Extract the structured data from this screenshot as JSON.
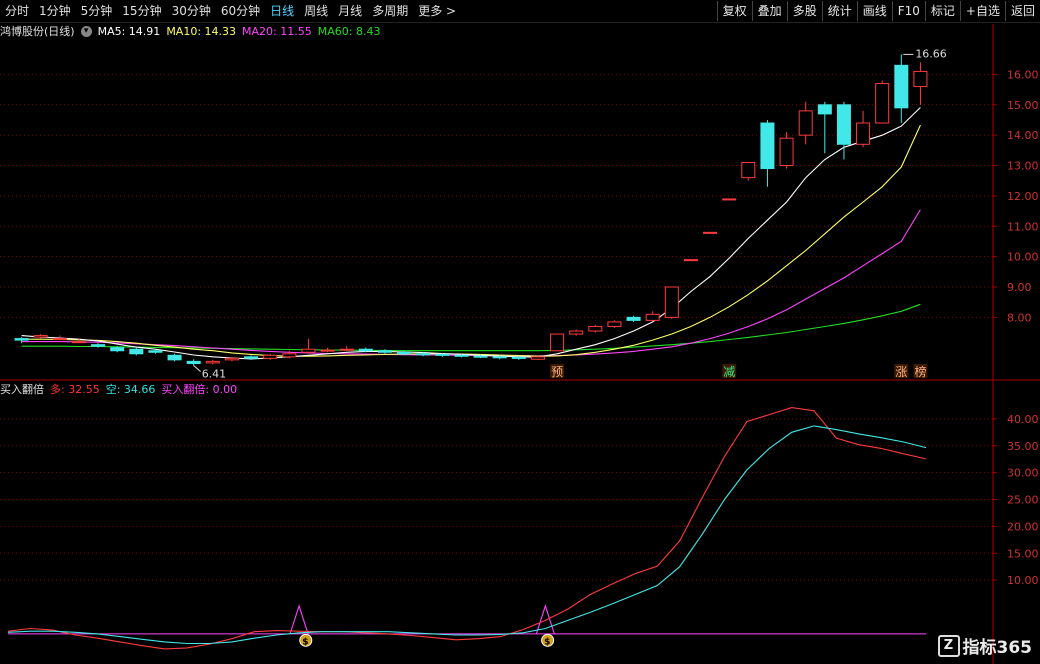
{
  "toolbar": {
    "periods": [
      "分时",
      "1分钟",
      "5分钟",
      "15分钟",
      "30分钟",
      "60分钟",
      "日线",
      "周线",
      "月线",
      "多周期",
      "更多 >"
    ],
    "active_period": "日线",
    "buttons": [
      "复权",
      "叠加",
      "多股",
      "统计",
      "画线",
      "F10",
      "标记",
      "+自选",
      "返回"
    ]
  },
  "main_panel": {
    "stock_label": "鸿博股份(日线)",
    "ma_indicators": [
      {
        "label": "MA5: 14.91",
        "color": "#ffffff"
      },
      {
        "label": "MA10: 14.33",
        "color": "#ffff66"
      },
      {
        "label": "MA20: 11.55",
        "color": "#ff44ff"
      },
      {
        "label": "MA60: 8.43",
        "color": "#22dd22"
      }
    ],
    "high_label": "16.66",
    "low_label": "6.41",
    "signals": [
      {
        "text": "预",
        "color": "#ffb080"
      },
      {
        "text": "减",
        "color": "#33ee88"
      },
      {
        "text": "涨",
        "color": "#ffb080"
      },
      {
        "text": "榜",
        "color": "#ffb080"
      }
    ]
  },
  "sub_panel": {
    "indicator_name": "买入翻倍",
    "values": [
      {
        "label": "多: 32.55",
        "color": "#ff3333"
      },
      {
        "label": "空: 34.66",
        "color": "#33e0e0"
      },
      {
        "label": "买入翻倍: 0.00",
        "color": "#ff44ff"
      }
    ]
  },
  "watermark": {
    "logo": "Z",
    "text": "指标365"
  },
  "colors": {
    "up": "#ff3b3b",
    "down": "#42e8e8",
    "ma5": "#ffffff",
    "ma10": "#ffff66",
    "ma20": "#ff44ff",
    "ma60": "#22dd22",
    "grid": "#8a0000",
    "axis_text": "#cc3333"
  },
  "chart_data": {
    "type": "candlestick",
    "price_axis_ticks": [
      "16.00",
      "15.00",
      "14.00",
      "13.00",
      "12.00",
      "11.00",
      "10.00",
      "9.00",
      "8.00"
    ],
    "price_range": [
      6.2,
      17.2
    ],
    "candles": [
      [
        7.3,
        7.25,
        7.35,
        7.15
      ],
      [
        7.35,
        7.4,
        7.45,
        7.3
      ],
      [
        7.3,
        7.3,
        7.4,
        7.25
      ],
      [
        7.2,
        7.2,
        7.3,
        7.15
      ],
      [
        7.1,
        7.05,
        7.15,
        7.0
      ],
      [
        7.0,
        6.9,
        7.05,
        6.85
      ],
      [
        6.95,
        6.8,
        7.0,
        6.75
      ],
      [
        6.9,
        6.85,
        6.95,
        6.8
      ],
      [
        6.75,
        6.6,
        6.8,
        6.55
      ],
      [
        6.55,
        6.48,
        6.62,
        6.41
      ],
      [
        6.5,
        6.55,
        6.6,
        6.45
      ],
      [
        6.6,
        6.65,
        6.7,
        6.55
      ],
      [
        6.7,
        6.65,
        6.75,
        6.6
      ],
      [
        6.65,
        6.75,
        6.8,
        6.6
      ],
      [
        6.7,
        6.8,
        6.9,
        6.65
      ],
      [
        6.85,
        6.95,
        7.3,
        6.8
      ],
      [
        6.9,
        6.92,
        7.0,
        6.85
      ],
      [
        6.95,
        6.95,
        7.05,
        6.9
      ],
      [
        6.95,
        6.9,
        7.0,
        6.85
      ],
      [
        6.9,
        6.85,
        6.95,
        6.8
      ],
      [
        6.85,
        6.8,
        6.9,
        6.75
      ],
      [
        6.8,
        6.78,
        6.85,
        6.72
      ],
      [
        6.78,
        6.75,
        6.82,
        6.7
      ],
      [
        6.75,
        6.72,
        6.8,
        6.68
      ],
      [
        6.72,
        6.7,
        6.78,
        6.66
      ],
      [
        6.7,
        6.68,
        6.75,
        6.62
      ],
      [
        6.68,
        6.65,
        6.72,
        6.6
      ],
      [
        6.62,
        6.7,
        6.72,
        6.6
      ],
      [
        6.9,
        7.45,
        7.45,
        6.88
      ],
      [
        7.45,
        7.55,
        7.6,
        7.4
      ],
      [
        7.55,
        7.7,
        7.75,
        7.5
      ],
      [
        7.7,
        7.85,
        7.9,
        7.65
      ],
      [
        8.0,
        7.9,
        8.05,
        7.85
      ],
      [
        7.9,
        8.1,
        8.2,
        7.88
      ],
      [
        8.0,
        9.0,
        9.0,
        7.95
      ],
      [
        9.9,
        9.9,
        9.9,
        9.9
      ],
      [
        10.8,
        10.8,
        10.8,
        10.8
      ],
      [
        11.9,
        11.9,
        11.9,
        11.9
      ],
      [
        12.6,
        13.1,
        13.1,
        12.5
      ],
      [
        14.4,
        12.9,
        14.5,
        12.3
      ],
      [
        13.0,
        13.9,
        14.1,
        12.9
      ],
      [
        14.0,
        14.8,
        15.1,
        13.7
      ],
      [
        15.0,
        14.7,
        15.1,
        13.4
      ],
      [
        15.0,
        13.7,
        15.1,
        13.2
      ],
      [
        13.7,
        14.4,
        14.8,
        13.6
      ],
      [
        14.4,
        15.7,
        15.8,
        14.4
      ],
      [
        16.3,
        14.9,
        16.66,
        14.4
      ],
      [
        15.6,
        16.1,
        16.4,
        15.0
      ]
    ],
    "ma5": [
      7.4,
      7.35,
      7.32,
      7.28,
      7.22,
      7.12,
      7.02,
      6.95,
      6.86,
      6.76,
      6.7,
      6.66,
      6.63,
      6.66,
      6.7,
      6.75,
      6.8,
      6.85,
      6.88,
      6.88,
      6.86,
      6.84,
      6.81,
      6.78,
      6.75,
      6.72,
      6.7,
      6.69,
      6.8,
      6.95,
      7.1,
      7.3,
      7.55,
      7.85,
      8.3,
      8.85,
      9.35,
      9.95,
      10.6,
      11.2,
      11.8,
      12.6,
      13.2,
      13.6,
      13.8,
      14.0,
      14.3,
      14.91
    ],
    "ma10": [
      7.28,
      7.28,
      7.27,
      7.26,
      7.24,
      7.2,
      7.15,
      7.08,
      7.02,
      6.95,
      6.9,
      6.83,
      6.78,
      6.74,
      6.72,
      6.72,
      6.73,
      6.75,
      6.76,
      6.78,
      6.79,
      6.8,
      6.8,
      6.79,
      6.78,
      6.76,
      6.74,
      6.72,
      6.73,
      6.77,
      6.85,
      6.95,
      7.08,
      7.25,
      7.45,
      7.7,
      8.0,
      8.35,
      8.75,
      9.2,
      9.7,
      10.2,
      10.75,
      11.3,
      11.8,
      12.3,
      12.95,
      14.33
    ],
    "ma20": [
      7.2,
      7.2,
      7.2,
      7.19,
      7.18,
      7.16,
      7.13,
      7.1,
      7.07,
      7.03,
      6.99,
      6.95,
      6.91,
      6.88,
      6.85,
      6.83,
      6.81,
      6.8,
      6.79,
      6.78,
      6.77,
      6.76,
      6.76,
      6.75,
      6.75,
      6.74,
      6.74,
      6.73,
      6.74,
      6.76,
      6.79,
      6.83,
      6.88,
      6.95,
      7.03,
      7.15,
      7.3,
      7.48,
      7.7,
      7.95,
      8.25,
      8.6,
      8.95,
      9.3,
      9.7,
      10.1,
      10.5,
      11.55
    ],
    "ma60": [
      7.05,
      7.05,
      7.05,
      7.04,
      7.04,
      7.03,
      7.02,
      7.01,
      7.0,
      6.99,
      6.98,
      6.97,
      6.96,
      6.95,
      6.94,
      6.93,
      6.92,
      6.92,
      6.91,
      6.91,
      6.9,
      6.9,
      6.9,
      6.9,
      6.9,
      6.9,
      6.9,
      6.9,
      6.91,
      6.93,
      6.95,
      6.98,
      7.02,
      7.06,
      7.1,
      7.15,
      7.2,
      7.27,
      7.34,
      7.42,
      7.5,
      7.6,
      7.7,
      7.8,
      7.92,
      8.05,
      8.2,
      8.43
    ],
    "sub_axis_ticks": [
      "40.00",
      "35.00",
      "30.00",
      "25.00",
      "20.00",
      "15.00",
      "10.00"
    ],
    "sub_range": [
      -3,
      45
    ],
    "duo": [
      0.5,
      1.0,
      0.7,
      -0.2,
      -0.8,
      -1.5,
      -2.2,
      -2.8,
      -2.6,
      -1.9,
      -0.9,
      0.4,
      0.6,
      0.5,
      0.4,
      0.4,
      0.2,
      0.0,
      -0.3,
      -0.7,
      -1.1,
      -0.9,
      -0.5,
      0.8,
      2.5,
      4.6,
      7.3,
      9.3,
      11.2,
      12.6,
      17.3,
      25.3,
      33.0,
      39.5,
      40.8,
      42.1,
      41.5,
      36.4,
      35.2,
      34.5,
      33.5,
      32.55
    ],
    "kong": [
      0.3,
      0.5,
      0.5,
      0.3,
      0.0,
      -0.5,
      -1.0,
      -1.5,
      -1.8,
      -1.8,
      -1.5,
      -0.8,
      -0.2,
      0.2,
      0.4,
      0.4,
      0.4,
      0.4,
      0.2,
      0.0,
      -0.2,
      -0.2,
      -0.1,
      0.2,
      1.0,
      2.5,
      4.0,
      5.6,
      7.3,
      9.0,
      12.5,
      18.5,
      25.0,
      30.5,
      34.5,
      37.5,
      38.7,
      38.0,
      37.2,
      36.5,
      35.7,
      34.66
    ],
    "buy_signal": [
      0,
      0,
      0,
      0,
      0,
      0,
      0,
      0,
      0,
      0,
      0,
      0,
      0,
      2.5,
      0,
      0,
      0,
      0,
      0,
      0,
      0,
      0,
      0,
      0,
      2.5,
      0,
      0,
      0,
      0,
      0,
      0,
      0,
      0,
      0,
      0,
      0,
      0,
      0,
      0,
      0,
      0,
      0
    ]
  }
}
